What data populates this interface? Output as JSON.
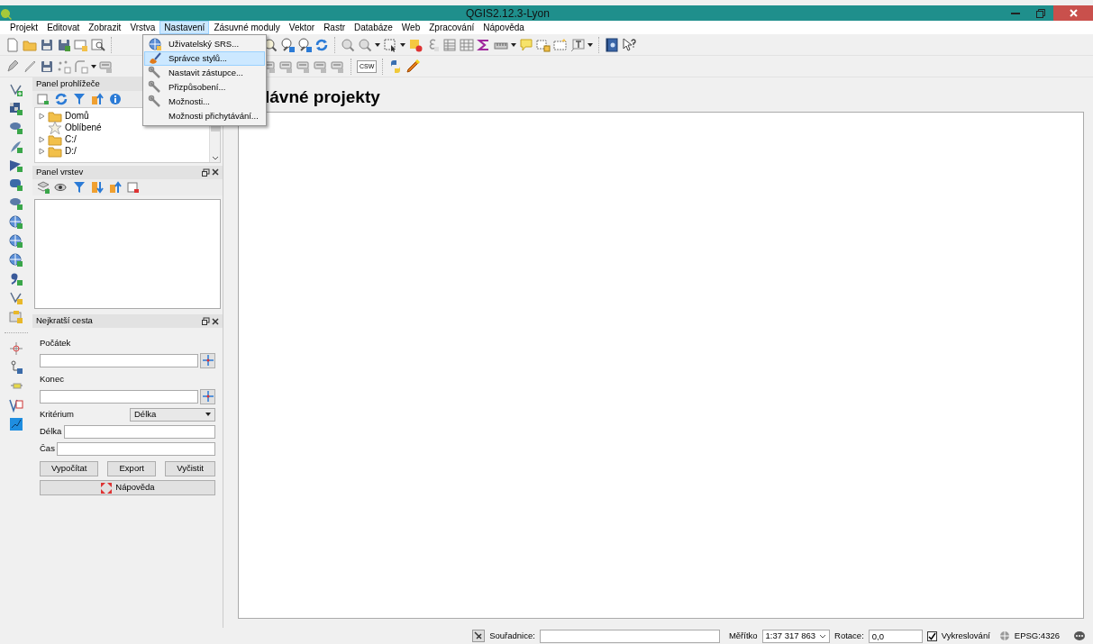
{
  "window": {
    "title": "QGIS2.12.3-Lyon"
  },
  "menu_bar": [
    {
      "label": "Projekt",
      "selected": false
    },
    {
      "label": "Editovat",
      "selected": false
    },
    {
      "label": "Zobrazit",
      "selected": false
    },
    {
      "label": "Vrstva",
      "selected": false
    },
    {
      "label": "Nastavení",
      "selected": true
    },
    {
      "label": "Zásuvné moduly",
      "selected": false
    },
    {
      "label": "Vektor",
      "selected": false
    },
    {
      "label": "Rastr",
      "selected": false
    },
    {
      "label": "Databáze",
      "selected": false
    },
    {
      "label": "Web",
      "selected": false
    },
    {
      "label": "Zpracování",
      "selected": false
    },
    {
      "label": "Nápověda",
      "selected": false
    }
  ],
  "open_menu": [
    {
      "label": "Uživatelský SRS...",
      "kind": "globe",
      "selected": false
    },
    {
      "label": "Správce stylů...",
      "kind": "brush",
      "selected": true
    },
    {
      "label": "Nastavit zástupce...",
      "kind": "wrench",
      "selected": false
    },
    {
      "label": "Přizpůsobení...",
      "kind": "wrench",
      "selected": false
    },
    {
      "label": "Možnosti...",
      "kind": "wrench",
      "selected": false
    },
    {
      "label": "Možnosti přichytávání...",
      "kind": "none",
      "selected": false
    }
  ],
  "toolbar": {
    "csw_button": "CSW"
  },
  "browser_panel": {
    "title": "Panel prohlížeče",
    "items": [
      {
        "label": "Domů",
        "kind": "folder",
        "has_children": true
      },
      {
        "label": "Oblíbené",
        "kind": "favorites",
        "has_children": false
      },
      {
        "label": "C:/",
        "kind": "folder",
        "has_children": true
      },
      {
        "label": "D:/",
        "kind": "folder",
        "has_children": true
      }
    ]
  },
  "layers_panel": {
    "title": "Panel vrstev"
  },
  "route_panel": {
    "title": "Nejkratší cesta",
    "start_label": "Počátek",
    "end_label": "Konec",
    "criterion_label": "Kritérium",
    "criterion_value": "Délka",
    "length_label": "Délka",
    "time_label": "Čas",
    "buttons": [
      "Vypočítat",
      "Export",
      "Vyčistit"
    ],
    "help_button": "Nápověda"
  },
  "main": {
    "heading": "lávné projekty"
  },
  "status_bar": {
    "coordinate_label": "Souřadnice:",
    "scale_label": "Měřítko",
    "scale_value": "1:37 317 863",
    "rotation_label": "Rotace:",
    "rotation_value": "0,0",
    "render_label": "Vykreslování",
    "render_checked": true,
    "crs": "EPSG:4326"
  }
}
